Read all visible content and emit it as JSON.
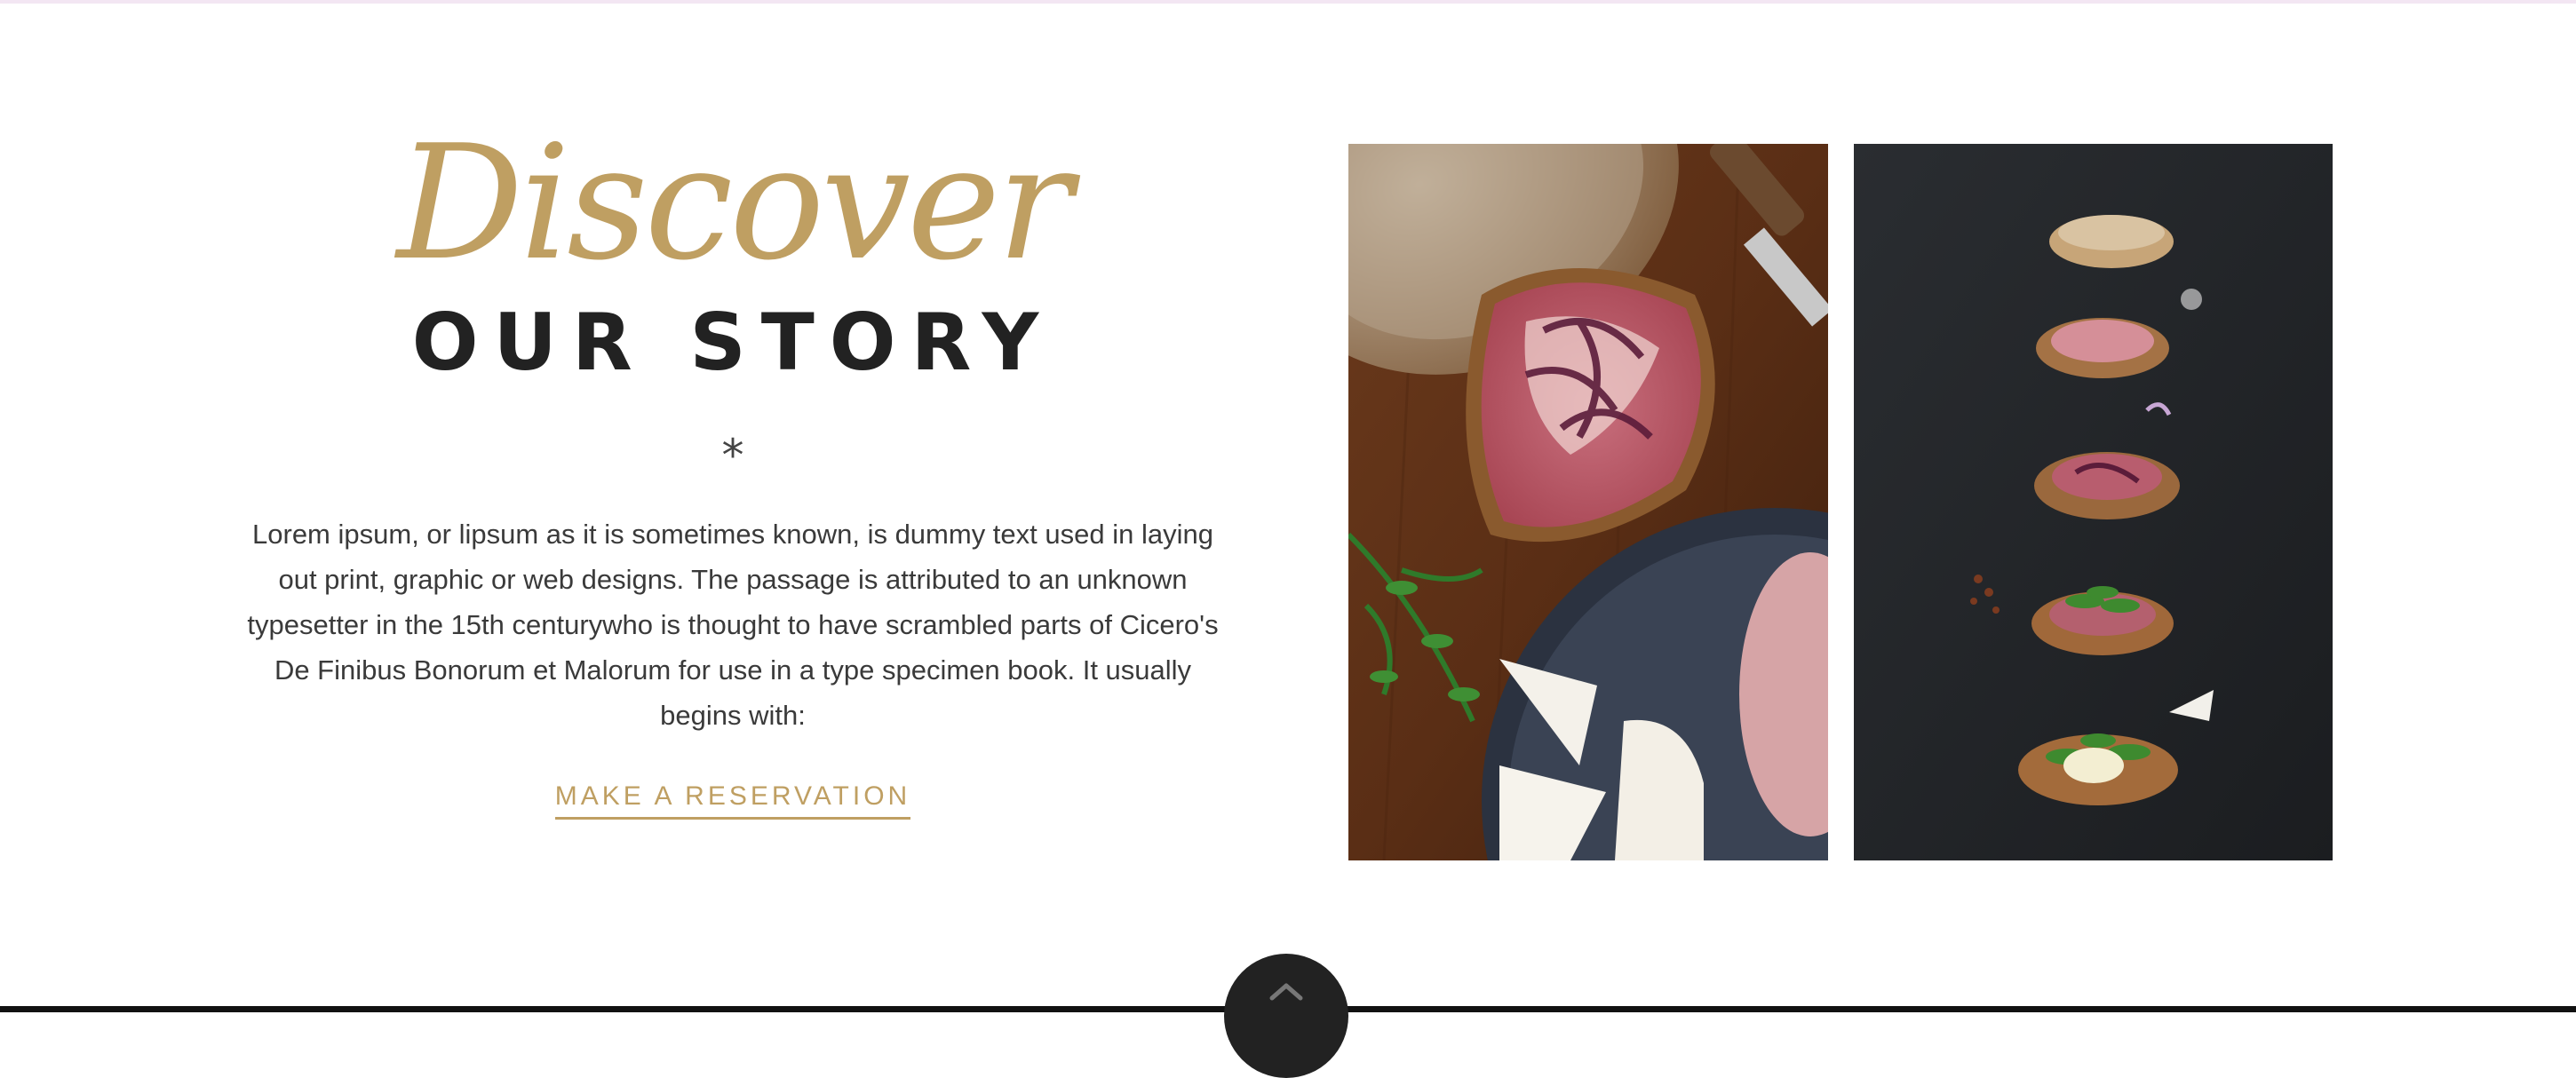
{
  "story": {
    "script_title": "Discover",
    "title": "OUR STORY",
    "divider": "*",
    "description": "Lorem ipsum, or lipsum as it is sometimes known, is dummy text used in laying out print, graphic or web designs. The passage is attributed to an unknown typesetter in the 15th centurywho is thought to have scrambled parts of Cicero's De Finibus Bonorum et Malorum for use in a type specimen book. It usually begins with:",
    "cta_label": "MAKE A RESERVATION"
  },
  "images": {
    "left": "bread-prosciutto-brie-board-photo",
    "right": "bruschetta-row-dark-slate-photo"
  },
  "scroll_top": {
    "icon": "chevron-up-icon"
  },
  "colors": {
    "accent": "#bf9f62",
    "heading": "#222222",
    "body_text": "#3a3a3a",
    "dark": "#111111"
  }
}
